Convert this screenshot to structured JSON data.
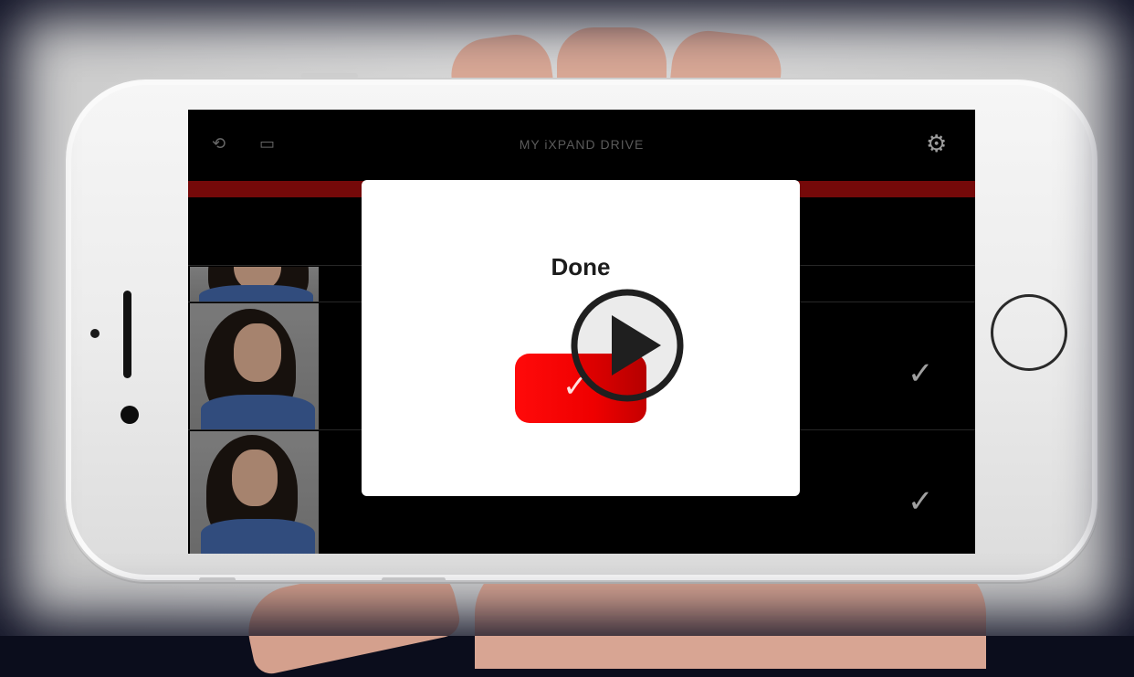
{
  "app": {
    "header": {
      "title": "MY iXPAND DRIVE",
      "left_icons": [
        "camera-rotate-icon",
        "cast-icon"
      ],
      "right_icon": "gear-icon"
    },
    "progress_color": "#8a0b0b",
    "rows": [
      {
        "thumb": "photo",
        "checked": false
      },
      {
        "thumb": "photo",
        "checked": true
      },
      {
        "thumb": "photo",
        "checked": true
      }
    ]
  },
  "dialog": {
    "title": "Done",
    "confirm_icon": "checkmark-icon",
    "confirm_color": "#ff0000"
  },
  "overlay": {
    "icon": "play-icon"
  },
  "glyphs": {
    "check": "✓",
    "gear": "⚙",
    "camera": "⟲",
    "cast": "▭"
  }
}
